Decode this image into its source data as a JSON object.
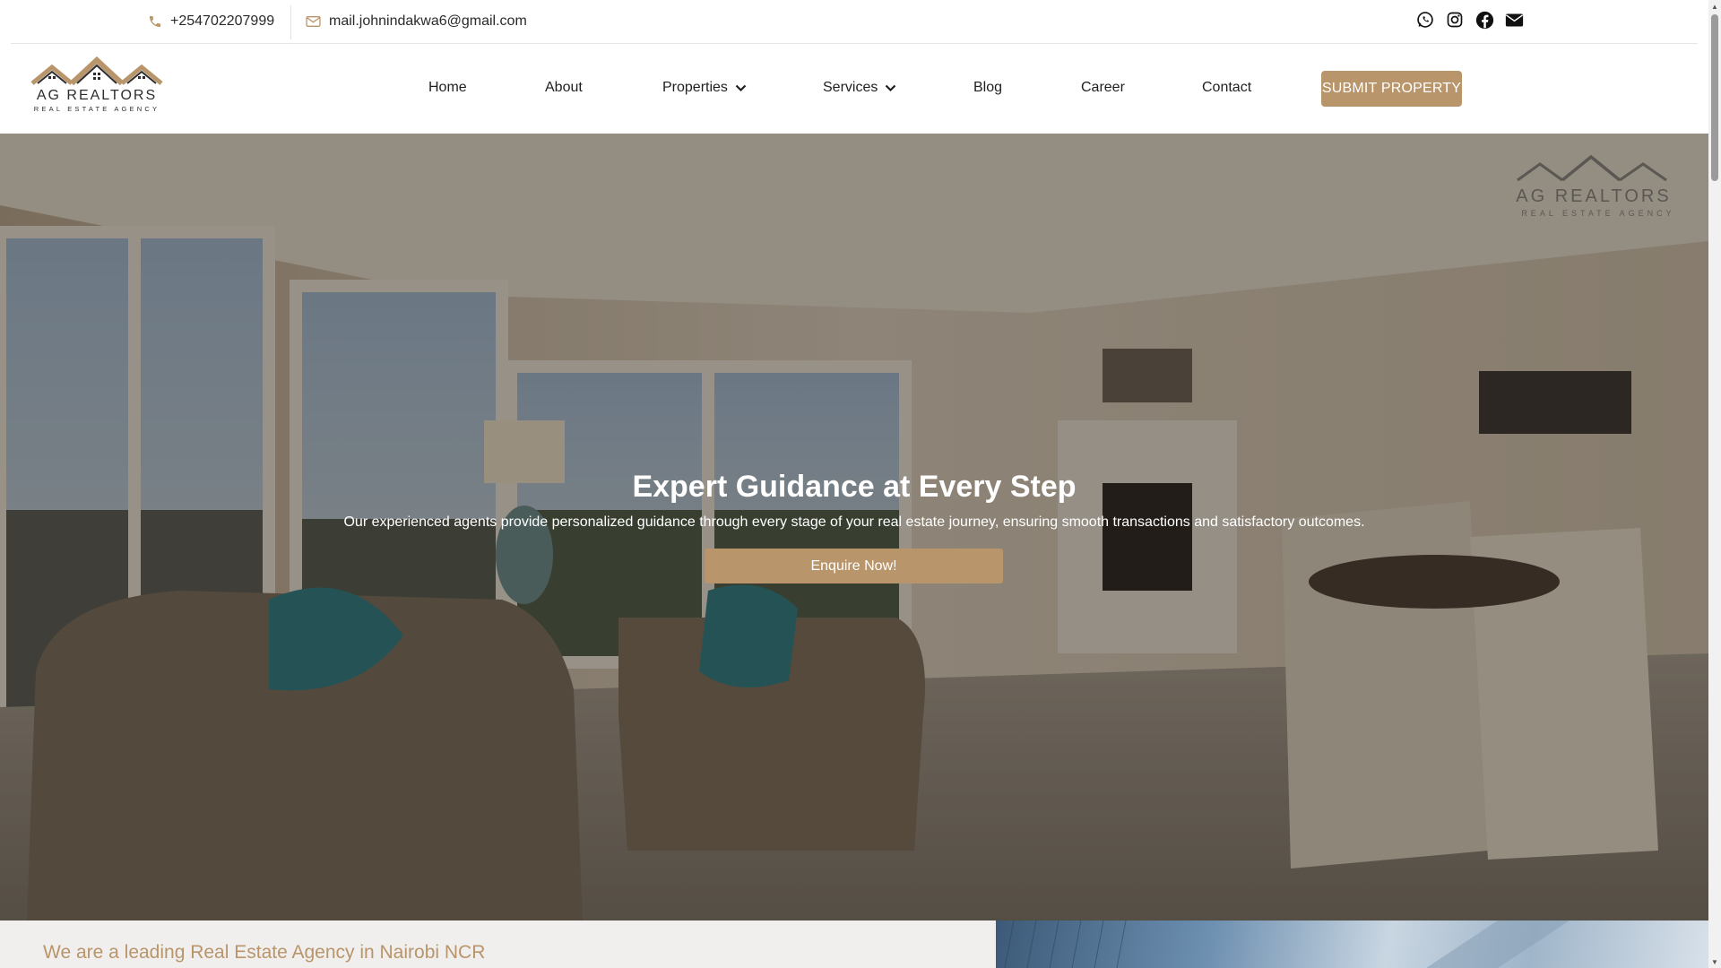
{
  "topbar": {
    "phone": "+254702207999",
    "email": "mail.johnindakwa6@gmail.com",
    "social": [
      "whatsapp-icon",
      "instagram-icon",
      "facebook-icon",
      "envelope-icon"
    ]
  },
  "logo": {
    "name": "AG REALTORS",
    "tagline": "REAL ESTATE AGENCY"
  },
  "nav": {
    "items": [
      {
        "label": "Home"
      },
      {
        "label": "About"
      },
      {
        "label": "Properties"
      },
      {
        "label": "Services"
      },
      {
        "label": "Blog"
      },
      {
        "label": "Career"
      },
      {
        "label": "Contact"
      }
    ],
    "cta": "SUBMIT PROPERTY"
  },
  "hero": {
    "title": "Expert Guidance at Every Step",
    "subtitle": "Our experienced agents provide personalized guidance through every stage of your real estate journey, ensuring smooth transactions and satisfactory outcomes.",
    "button": "Enquire Now!"
  },
  "about": {
    "tagline": "We are a leading Real Estate Agency in Nairobi NCR"
  },
  "colors": {
    "accent": "#b8956a",
    "text": "#1f1f1f"
  }
}
